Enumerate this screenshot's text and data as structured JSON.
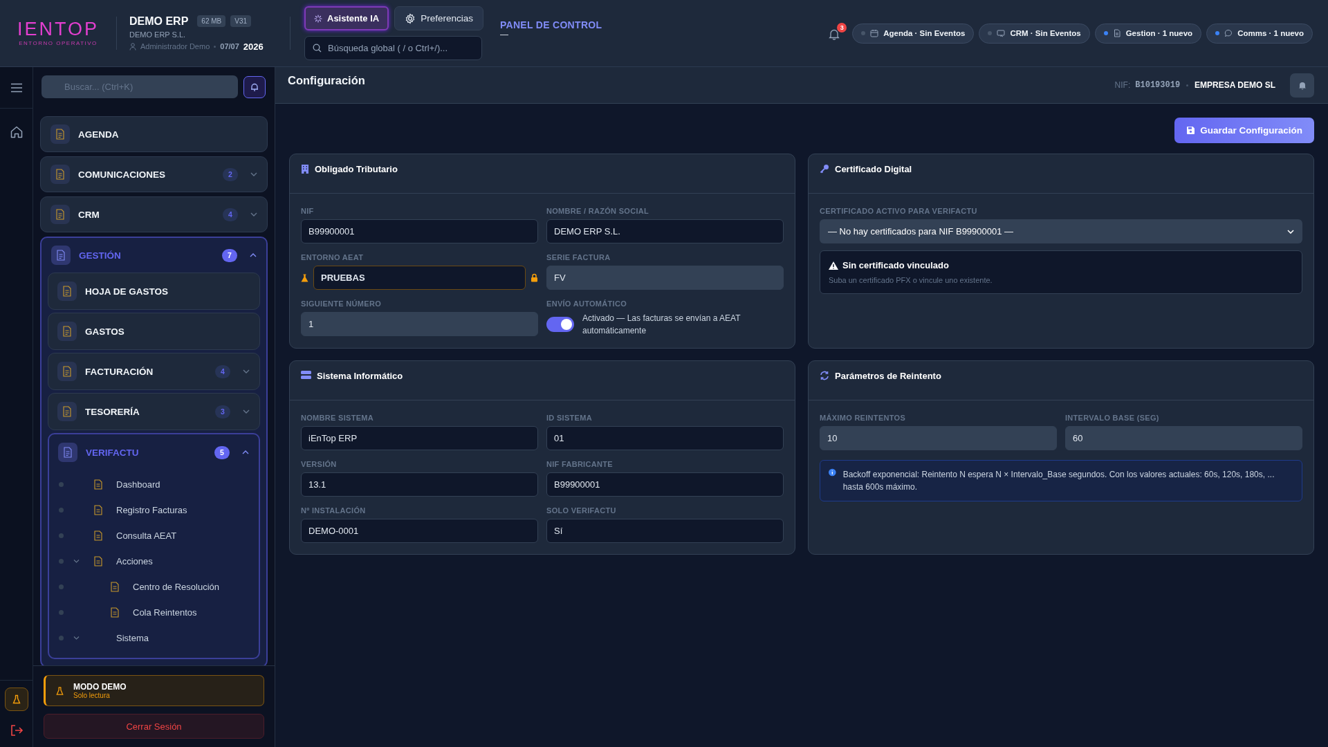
{
  "header": {
    "logo": {
      "text": "IENTOP",
      "tagline": "ENTORNO OPERATIVO"
    },
    "app": {
      "name": "DEMO ERP",
      "badges": [
        "62 MB",
        "V31"
      ],
      "company": "DEMO ERP S.L.",
      "user": "Administrador Demo",
      "date": "07/07",
      "year": "2026"
    },
    "buttons": [
      {
        "label": "Asistente IA",
        "selected": true
      },
      {
        "label": "Preferencias",
        "selected": false
      }
    ],
    "search": {
      "placeholder": "Búsqueda global ( / o Ctrl+/)..."
    },
    "breadcrumb": {
      "title": "PANEL DE CONTROL",
      "subtitle": "—"
    },
    "notifications": "3",
    "pills": [
      {
        "label": "Agenda · Sin Eventos",
        "unread": false
      },
      {
        "label": "CRM · Sin Eventos",
        "unread": false
      },
      {
        "label": "Gestion · 1 nuevo",
        "unread": true
      },
      {
        "label": "Comms · 1 nuevo",
        "unread": true
      }
    ]
  },
  "sidebar": {
    "search": {
      "placeholder": "Buscar... (Ctrl+K)"
    },
    "items": [
      {
        "label": "AGENDA",
        "active": false,
        "collapsible": false
      },
      {
        "label": "COMUNICACIONES",
        "badge": "2",
        "active": false,
        "collapsible": true,
        "expanded": false
      },
      {
        "label": "CRM",
        "badge": "4",
        "active": false,
        "collapsible": true,
        "expanded": false
      },
      {
        "label": "GESTIÓN",
        "badge": "7",
        "active": true,
        "collapsible": true,
        "expanded": true,
        "children": [
          {
            "label": "HOJA DE GASTOS",
            "active": false,
            "collapsible": false
          },
          {
            "label": "GASTOS",
            "active": false,
            "collapsible": false
          },
          {
            "label": "FACTURACIÓN",
            "badge": "4",
            "active": false,
            "collapsible": true,
            "expanded": false
          },
          {
            "label": "TESORERÍA",
            "badge": "3",
            "active": false,
            "collapsible": true,
            "expanded": false
          },
          {
            "label": "VERIFACTU",
            "badge": "5",
            "active": true,
            "collapsible": true,
            "expanded": true,
            "children": [
              {
                "label": "Dashboard",
                "icon": true,
                "collapsible": false
              },
              {
                "label": "Registro Facturas",
                "icon": true,
                "collapsible": false
              },
              {
                "label": "Consulta AEAT",
                "icon": true,
                "collapsible": false
              },
              {
                "label": "Acciones",
                "icon": true,
                "collapsible": true,
                "children": [
                  {
                    "label": "Centro de Resolución",
                    "icon": true,
                    "collapsible": false
                  },
                  {
                    "label": "Cola Reintentos",
                    "icon": true,
                    "collapsible": false
                  }
                ]
              },
              {
                "label": "Sistema",
                "icon": false,
                "collapsible": true
              }
            ]
          }
        ]
      }
    ],
    "demo": {
      "title": "MODO DEMO",
      "subtitle": "Solo lectura"
    },
    "logout": "Cerrar Sesión"
  },
  "main": {
    "title": "Configuración",
    "nif_label": "NIF:",
    "nif": "B10193019",
    "company": "EMPRESA DEMO SL",
    "save": "Guardar Configuración",
    "cards": [
      {
        "title": "Obligado Tributario",
        "fields": [
          {
            "kind": "input",
            "label": "NIF",
            "value": "B99900001",
            "editable": false
          },
          {
            "kind": "input",
            "label": "NOMBRE / RAZÓN SOCIAL",
            "value": "DEMO ERP S.L.",
            "editable": false
          },
          {
            "kind": "env",
            "label": "ENTORNO AEAT",
            "value": "PRUEBAS"
          },
          {
            "kind": "input",
            "label": "SERIE FACTURA",
            "value": "FV",
            "editable": true
          },
          {
            "kind": "input",
            "label": "SIGUIENTE NÚMERO",
            "value": "1",
            "editable": true
          },
          {
            "kind": "toggle",
            "label": "ENVÍO AUTOMÁTICO",
            "on": true,
            "text": "Activado — Las facturas se envían a AEAT automáticamente"
          }
        ]
      },
      {
        "title": "Certificado Digital",
        "fields": [
          {
            "kind": "select",
            "label": "CERTIFICADO ACTIVO PARA VERIFACTU",
            "value": "— No hay certificados para NIF B99900001 —"
          },
          {
            "kind": "alert",
            "title": "Sin certificado vinculado",
            "text": "Suba un certificado PFX o vincule uno existente."
          }
        ]
      },
      {
        "title": "Sistema Informático",
        "fields": [
          {
            "kind": "input",
            "label": "NOMBRE SISTEMA",
            "value": "iEnTop ERP",
            "editable": false
          },
          {
            "kind": "input",
            "label": "ID SISTEMA",
            "value": "01",
            "editable": false
          },
          {
            "kind": "input",
            "label": "VERSIÓN",
            "value": "13.1",
            "editable": false
          },
          {
            "kind": "input",
            "label": "NIF FABRICANTE",
            "value": "B99900001",
            "editable": false
          },
          {
            "kind": "input",
            "label": "Nº INSTALACIÓN",
            "value": "DEMO-0001",
            "editable": false
          },
          {
            "kind": "input",
            "label": "SOLO VERIFACTU",
            "value": "Sí",
            "editable": false
          }
        ]
      },
      {
        "title": "Parámetros de Reintento",
        "fields": [
          {
            "kind": "input",
            "label": "MÁXIMO REINTENTOS",
            "value": "10",
            "editable": true
          },
          {
            "kind": "input",
            "label": "INTERVALO BASE (SEG)",
            "value": "60",
            "editable": true
          },
          {
            "kind": "note",
            "text": "Backoff exponencial: Reintento N espera N × Intervalo_Base segundos. Con los valores actuales: 60s, 120s, 180s, ... hasta 600s máximo."
          }
        ]
      }
    ]
  }
}
